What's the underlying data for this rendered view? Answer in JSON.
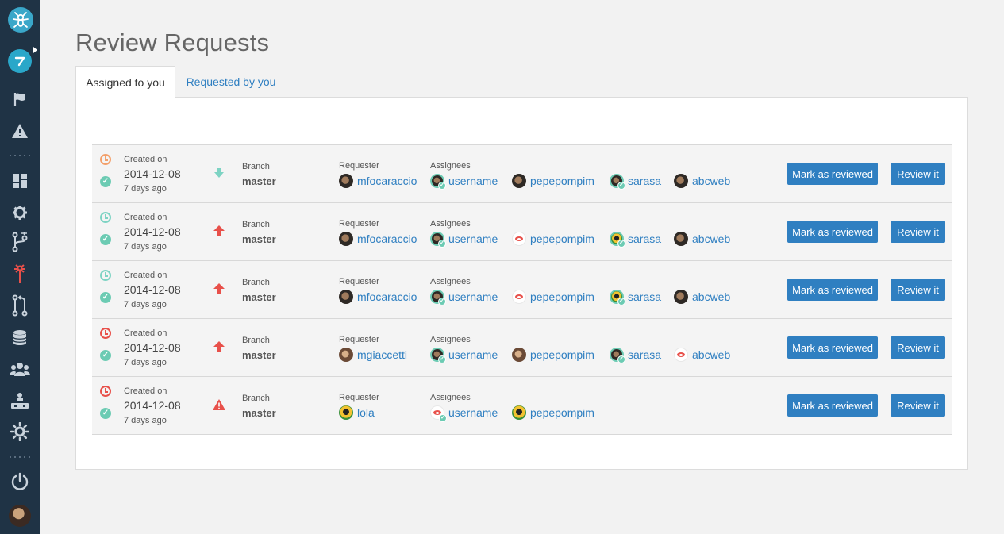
{
  "sidebar": {
    "icons": [
      "app-logo-icon",
      "plastic-brand-icon",
      "flag-icon",
      "warning-icon",
      "dashboard-icon",
      "gear-icon",
      "branches-icon",
      "code-review-icon",
      "merge-icon",
      "database-icon",
      "users-icon",
      "organization-icon",
      "settings-cog-icon",
      "power-icon",
      "user-avatar"
    ]
  },
  "page": {
    "title": "Review Requests",
    "tabs": [
      {
        "label": "Assigned to you"
      },
      {
        "label": "Requested by you"
      }
    ]
  },
  "labels": {
    "created_on": "Created on",
    "branch": "Branch",
    "requester": "Requester",
    "assignees": "Assignees",
    "mark_reviewed": "Mark as reviewed",
    "review_it": "Review it"
  },
  "colors": {
    "accent": "#2f7fc1",
    "sidebar": "#1f3345",
    "clock_orange": "#f3a06b",
    "clock_teal": "#7dd3c3",
    "clock_red": "#e8504a",
    "check": "#6ccbb3",
    "priority_red": "#e8504a",
    "priority_low": "#6ccbb3"
  },
  "rows": [
    {
      "status_color": "orange",
      "date": "2014-12-08",
      "ago": "7 days ago",
      "priority": "low",
      "branch": "master",
      "requester": {
        "name": "mfocaraccio",
        "avatar": "dark"
      },
      "assignees": [
        {
          "name": "username",
          "avatar": "dark",
          "reviewed": true
        },
        {
          "name": "pepepompim",
          "avatar": "dark",
          "reviewed": false
        },
        {
          "name": "sarasa",
          "avatar": "dark",
          "reviewed": true
        },
        {
          "name": "abcweb",
          "avatar": "dark",
          "reviewed": false
        }
      ]
    },
    {
      "status_color": "teal",
      "date": "2014-12-08",
      "ago": "7 days ago",
      "priority": "high",
      "branch": "master",
      "requester": {
        "name": "mfocaraccio",
        "avatar": "dark"
      },
      "assignees": [
        {
          "name": "username",
          "avatar": "dark",
          "reviewed": true
        },
        {
          "name": "pepepompim",
          "avatar": "red",
          "reviewed": false
        },
        {
          "name": "sarasa",
          "avatar": "green",
          "reviewed": true
        },
        {
          "name": "abcweb",
          "avatar": "dark",
          "reviewed": false
        }
      ]
    },
    {
      "status_color": "teal",
      "date": "2014-12-08",
      "ago": "7 days ago",
      "priority": "high",
      "branch": "master",
      "requester": {
        "name": "mfocaraccio",
        "avatar": "dark"
      },
      "assignees": [
        {
          "name": "username",
          "avatar": "dark",
          "reviewed": true
        },
        {
          "name": "pepepompim",
          "avatar": "red",
          "reviewed": false
        },
        {
          "name": "sarasa",
          "avatar": "green",
          "reviewed": true
        },
        {
          "name": "abcweb",
          "avatar": "dark",
          "reviewed": false
        }
      ]
    },
    {
      "status_color": "red",
      "date": "2014-12-08",
      "ago": "7 days ago",
      "priority": "high",
      "branch": "master",
      "requester": {
        "name": "mgiaccetti",
        "avatar": "warm"
      },
      "assignees": [
        {
          "name": "username",
          "avatar": "dark",
          "reviewed": true
        },
        {
          "name": "pepepompim",
          "avatar": "warm",
          "reviewed": false
        },
        {
          "name": "sarasa",
          "avatar": "dark",
          "reviewed": true
        },
        {
          "name": "abcweb",
          "avatar": "red",
          "reviewed": false
        }
      ]
    },
    {
      "status_color": "red",
      "date": "2014-12-08",
      "ago": "7 days ago",
      "priority": "critical",
      "branch": "master",
      "requester": {
        "name": "lola",
        "avatar": "green"
      },
      "assignees": [
        {
          "name": "username",
          "avatar": "red",
          "reviewed": true
        },
        {
          "name": "pepepompim",
          "avatar": "green",
          "reviewed": false
        }
      ]
    }
  ]
}
